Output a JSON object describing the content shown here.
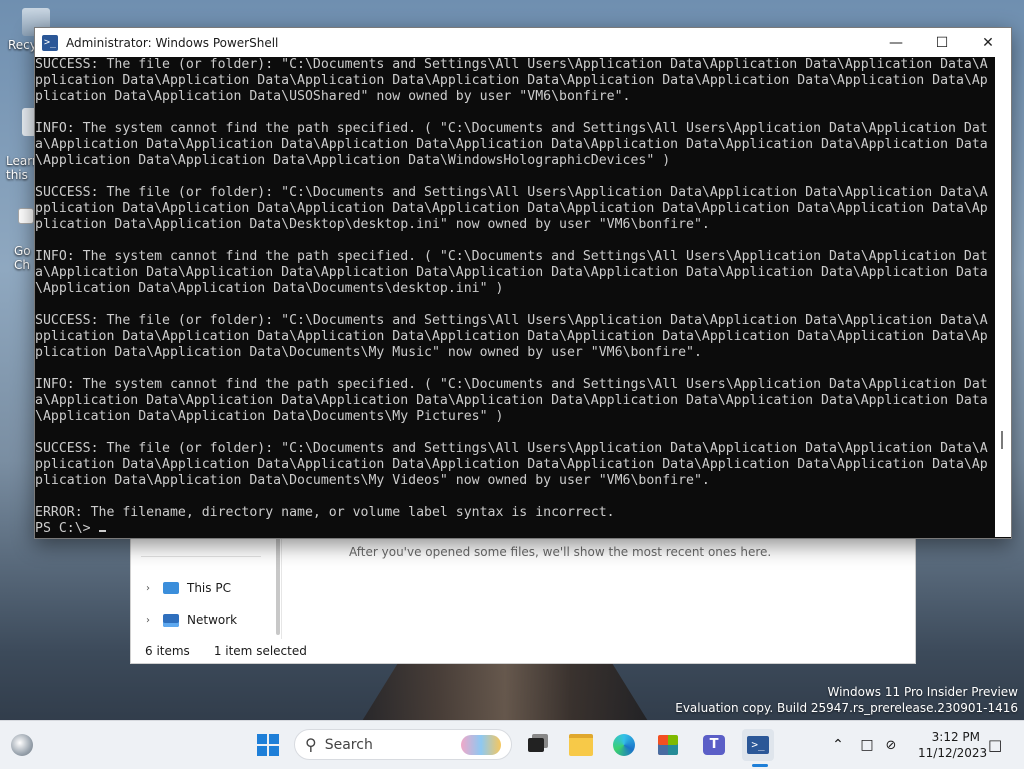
{
  "desktop": {
    "icons": [
      {
        "label": "Recy"
      },
      {
        "label": "Learn\nthis"
      },
      {
        "label": "Go\nCh"
      }
    ],
    "watermark": {
      "line1": "Windows 11 Pro Insider Preview",
      "line2": "Evaluation copy. Build 25947.rs_prerelease.230901-1416"
    }
  },
  "explorer": {
    "nav_items": [
      {
        "label": "This PC",
        "icon": "computer-icon"
      },
      {
        "label": "Network",
        "icon": "network-icon"
      }
    ],
    "empty_message": "After you've opened some files, we'll show the most recent ones here.",
    "status_items": "6 items",
    "status_selected": "1 item selected"
  },
  "powershell": {
    "title": "Administrator: Windows PowerShell",
    "controls": {
      "minimize": "—",
      "maximize": "☐",
      "close": "✕"
    },
    "lines": [
      "SUCCESS: The file (or folder): \"C:\\Documents and Settings\\All Users\\Application Data\\Application Data\\Application Data\\A",
      "pplication Data\\Application Data\\Application Data\\Application Data\\Application Data\\Application Data\\Application Data\\Ap",
      "plication Data\\Application Data\\USOShared\" now owned by user \"VM6\\bonfire\".",
      "",
      "INFO: The system cannot find the path specified. ( \"C:\\Documents and Settings\\All Users\\Application Data\\Application Dat",
      "a\\Application Data\\Application Data\\Application Data\\Application Data\\Application Data\\Application Data\\Application Data",
      "\\Application Data\\Application Data\\Application Data\\WindowsHolographicDevices\" )",
      "",
      "SUCCESS: The file (or folder): \"C:\\Documents and Settings\\All Users\\Application Data\\Application Data\\Application Data\\A",
      "pplication Data\\Application Data\\Application Data\\Application Data\\Application Data\\Application Data\\Application Data\\Ap",
      "plication Data\\Application Data\\Desktop\\desktop.ini\" now owned by user \"VM6\\bonfire\".",
      "",
      "INFO: The system cannot find the path specified. ( \"C:\\Documents and Settings\\All Users\\Application Data\\Application Dat",
      "a\\Application Data\\Application Data\\Application Data\\Application Data\\Application Data\\Application Data\\Application Data",
      "\\Application Data\\Application Data\\Documents\\desktop.ini\" )",
      "",
      "SUCCESS: The file (or folder): \"C:\\Documents and Settings\\All Users\\Application Data\\Application Data\\Application Data\\A",
      "pplication Data\\Application Data\\Application Data\\Application Data\\Application Data\\Application Data\\Application Data\\Ap",
      "plication Data\\Application Data\\Documents\\My Music\" now owned by user \"VM6\\bonfire\".",
      "",
      "INFO: The system cannot find the path specified. ( \"C:\\Documents and Settings\\All Users\\Application Data\\Application Dat",
      "a\\Application Data\\Application Data\\Application Data\\Application Data\\Application Data\\Application Data\\Application Data",
      "\\Application Data\\Application Data\\Documents\\My Pictures\" )",
      "",
      "SUCCESS: The file (or folder): \"C:\\Documents and Settings\\All Users\\Application Data\\Application Data\\Application Data\\A",
      "pplication Data\\Application Data\\Application Data\\Application Data\\Application Data\\Application Data\\Application Data\\Ap",
      "plication Data\\Application Data\\Documents\\My Videos\" now owned by user \"VM6\\bonfire\".",
      "",
      "ERROR: The filename, directory name, or volume label syntax is incorrect.",
      "PS C:\\> "
    ]
  },
  "taskbar": {
    "search_placeholder": "Search",
    "apps": [
      {
        "name": "widgets-icon"
      },
      {
        "name": "start-icon"
      },
      {
        "name": "search-icon"
      },
      {
        "name": "task-view-icon"
      },
      {
        "name": "file-explorer-icon"
      },
      {
        "name": "edge-icon"
      },
      {
        "name": "store-icon"
      },
      {
        "name": "teams-icon"
      },
      {
        "name": "powershell-icon"
      }
    ],
    "clock": {
      "time": "3:12 PM",
      "date": "11/12/2023"
    }
  }
}
